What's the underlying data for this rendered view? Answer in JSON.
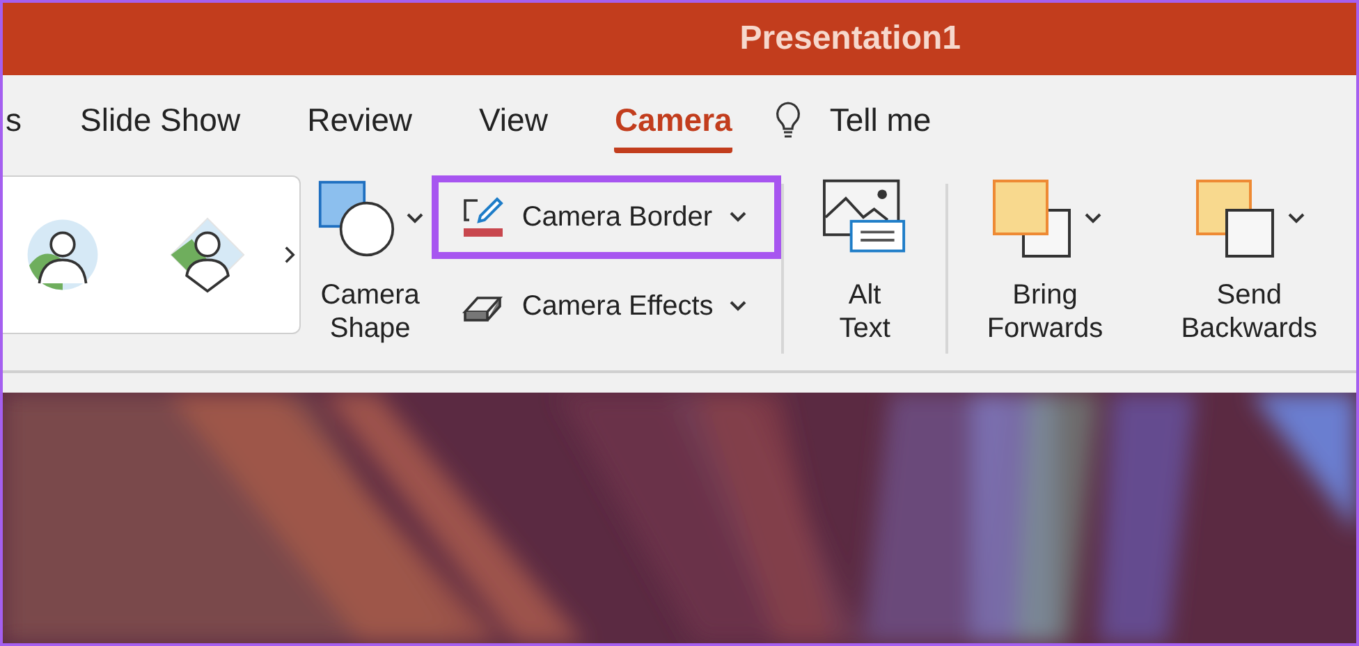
{
  "window": {
    "title": "Presentation1"
  },
  "tabs": [
    {
      "label": "s",
      "selected": false
    },
    {
      "label": "Slide Show",
      "selected": false
    },
    {
      "label": "Review",
      "selected": false
    },
    {
      "label": "View",
      "selected": false
    },
    {
      "label": "Camera",
      "selected": true
    }
  ],
  "tell_me": {
    "label": "Tell me"
  },
  "gallery": [
    {
      "kind": "circle"
    },
    {
      "kind": "diamond"
    }
  ],
  "camera_shape": {
    "label": "Camera Shape"
  },
  "camera_buttons": [
    {
      "label": "Camera Border",
      "kind": "border",
      "highlighted": true
    },
    {
      "label": "Camera Effects",
      "kind": "effects",
      "highlighted": false
    }
  ],
  "arrange": [
    {
      "label": "Alt Text",
      "kind": "alt-text",
      "dropdown": false
    },
    {
      "label": "Bring Forwards",
      "kind": "bring-forward",
      "dropdown": true
    },
    {
      "label": "Send Backwards",
      "kind": "send-backward",
      "dropdown": true
    }
  ]
}
